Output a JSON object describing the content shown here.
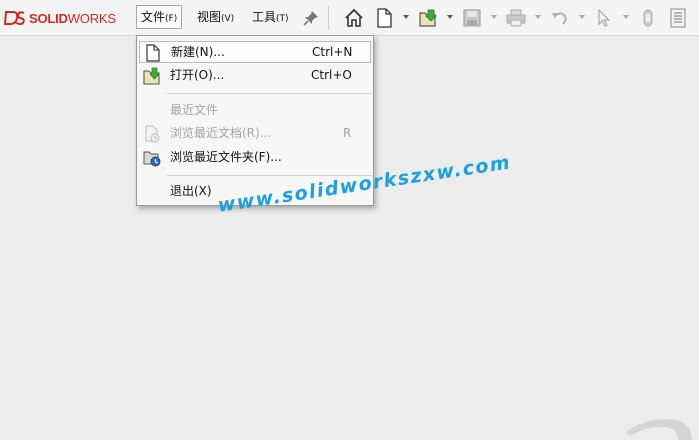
{
  "app": {
    "logo_prefix": "SOLID",
    "logo_suffix": "WORKS",
    "brand_color": "#d52b1e"
  },
  "menubar": {
    "items": [
      {
        "label": "文件",
        "mnemonic": "(F)",
        "active": true
      },
      {
        "label": "视图",
        "mnemonic": "(V)",
        "active": false
      },
      {
        "label": "工具",
        "mnemonic": "(T)",
        "active": false
      }
    ],
    "pin_icon": "pin-icon"
  },
  "toolbar": {
    "icons": [
      "home-icon",
      "new-document-icon",
      "open-folder-icon",
      "save-icon",
      "print-icon",
      "undo-icon",
      "select-cursor-icon",
      "rebuild-icon",
      "options-icon"
    ]
  },
  "file_menu": {
    "new": {
      "label": "新建(N)...",
      "shortcut": "Ctrl+N"
    },
    "open": {
      "label": "打开(O)...",
      "shortcut": "Ctrl+O"
    },
    "recent_header": "最近文件",
    "browse_recent_docs": {
      "label": "浏览最近文档(R)...",
      "shortcut": "R"
    },
    "browse_recent_folders": {
      "label": "浏览最近文件夹(F)..."
    },
    "exit": {
      "label": "退出(X)"
    }
  },
  "watermark": {
    "text": "www.solidworkszxw.com",
    "color": "#1aa0e3"
  }
}
